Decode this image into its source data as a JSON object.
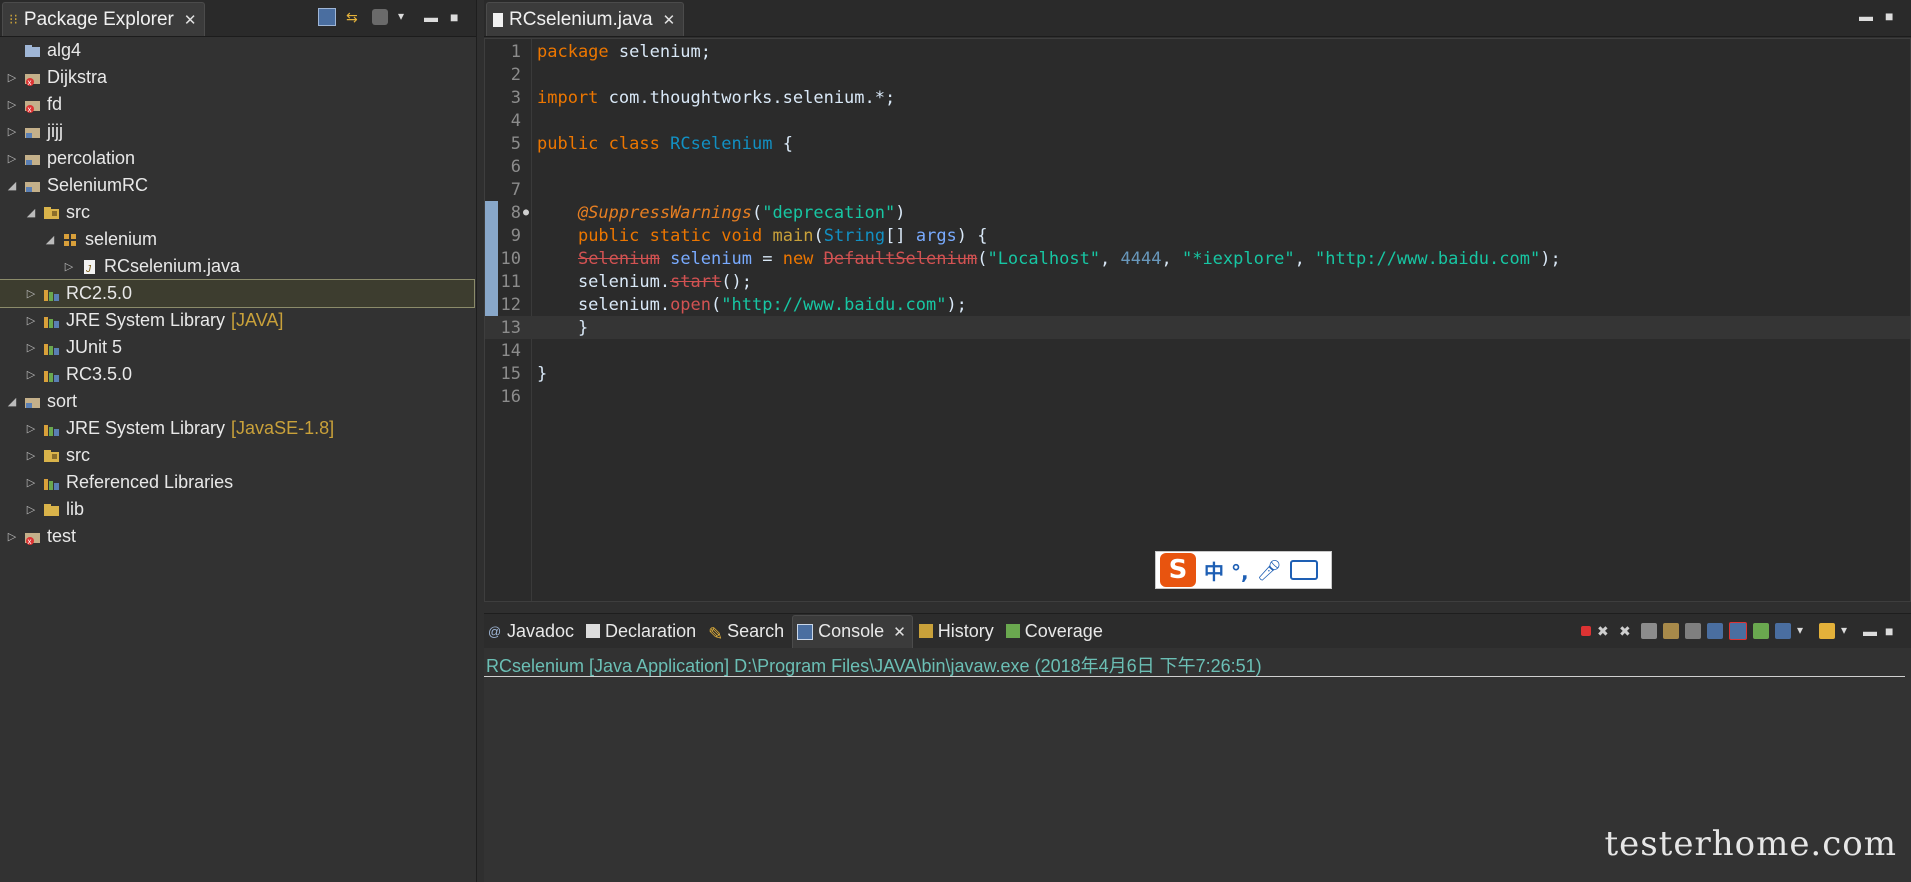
{
  "package_explorer": {
    "tab_title": "Package Explorer",
    "tree": [
      {
        "label": "alg4",
        "icon": "project-folder-icon",
        "twisty": ""
      },
      {
        "label": "Dijkstra",
        "icon": "java-project-error-icon",
        "twisty": "▷"
      },
      {
        "label": "fd",
        "icon": "java-project-error-icon",
        "twisty": "▷"
      },
      {
        "label": "jijj",
        "icon": "java-project-icon",
        "twisty": "▷"
      },
      {
        "label": "percolation",
        "icon": "java-project-icon",
        "twisty": "▷"
      },
      {
        "label": "SeleniumRC",
        "icon": "java-project-icon",
        "twisty": "◢"
      },
      {
        "label": "src",
        "icon": "source-folder-icon",
        "twisty": "◢"
      },
      {
        "label": "selenium",
        "icon": "package-icon",
        "twisty": "◢"
      },
      {
        "label": "RCselenium.java",
        "icon": "java-file-icon",
        "twisty": "▷"
      },
      {
        "label": "RC2.5.0",
        "icon": "library-icon",
        "twisty": "▷"
      },
      {
        "label": "JRE System Library",
        "decoration": "[JAVA]",
        "icon": "library-icon",
        "twisty": "▷"
      },
      {
        "label": "JUnit 5",
        "icon": "library-icon",
        "twisty": "▷"
      },
      {
        "label": "RC3.5.0",
        "icon": "library-icon",
        "twisty": "▷"
      },
      {
        "label": "sort",
        "icon": "java-project-icon",
        "twisty": "◢"
      },
      {
        "label": "JRE System Library",
        "decoration": "[JavaSE-1.8]",
        "icon": "library-icon",
        "twisty": "▷"
      },
      {
        "label": "src",
        "icon": "source-folder-icon",
        "twisty": "▷"
      },
      {
        "label": "Referenced Libraries",
        "icon": "library-icon",
        "twisty": "▷"
      },
      {
        "label": "lib",
        "icon": "folder-icon",
        "twisty": "▷"
      },
      {
        "label": "test",
        "icon": "java-project-error-icon",
        "twisty": "▷"
      }
    ]
  },
  "editor": {
    "tab_title": "RCselenium.java",
    "line_numbers": [
      "1",
      "2",
      "3",
      "4",
      "5",
      "6",
      "7",
      "8",
      "9",
      "10",
      "11",
      "12",
      "13",
      "14",
      "15",
      "16"
    ]
  },
  "ime": {
    "logo": "S",
    "text": "中 °,"
  },
  "bottom_panel": {
    "tabs": [
      {
        "label": "Javadoc",
        "icon": "javadoc-icon"
      },
      {
        "label": "Declaration",
        "icon": "declaration-icon"
      },
      {
        "label": "Search",
        "icon": "search-icon"
      },
      {
        "label": "Console",
        "icon": "console-icon",
        "active": true
      },
      {
        "label": "History",
        "icon": "history-icon"
      },
      {
        "label": "Coverage",
        "icon": "coverage-icon"
      }
    ],
    "console_header": "RCselenium [Java Application] D:\\Program Files\\JAVA\\bin\\javaw.exe (2018年4月6日 下午7:26:51)"
  },
  "watermark": "testerhome.com",
  "colors": {
    "accent_blue": "#88a7c9",
    "keyword": "#ec7600",
    "string": "#17c6a3",
    "deprecated": "#d25252"
  }
}
